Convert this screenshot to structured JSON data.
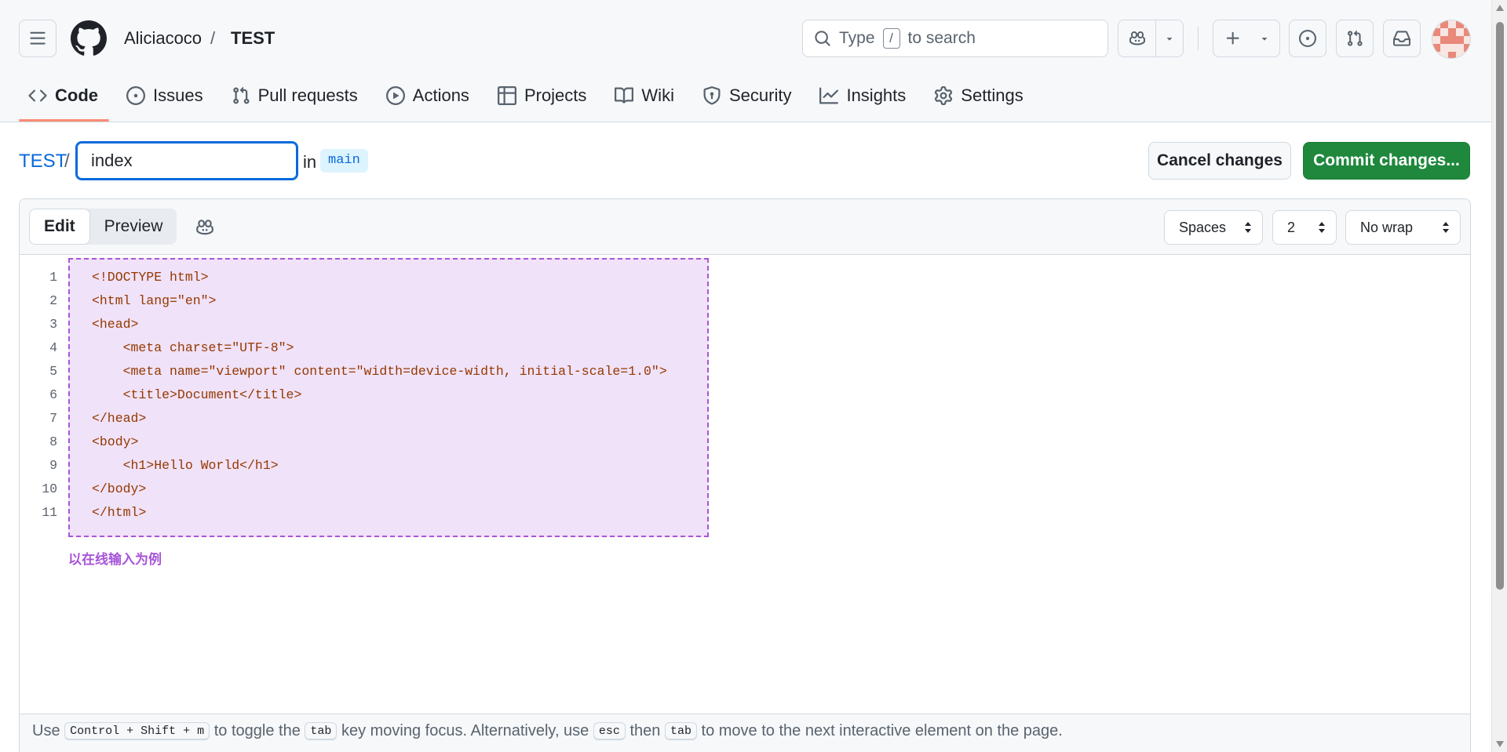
{
  "header": {
    "owner": "Aliciacoco",
    "separator": "/",
    "repo": "TEST",
    "search": {
      "prefix": "Type",
      "key": "/",
      "suffix": "to search"
    }
  },
  "nav": {
    "items": [
      {
        "label": "Code",
        "icon": "code-icon",
        "active": true
      },
      {
        "label": "Issues",
        "icon": "issue-opened-icon"
      },
      {
        "label": "Pull requests",
        "icon": "git-pull-request-icon"
      },
      {
        "label": "Actions",
        "icon": "play-icon"
      },
      {
        "label": "Projects",
        "icon": "table-icon"
      },
      {
        "label": "Wiki",
        "icon": "book-icon"
      },
      {
        "label": "Security",
        "icon": "shield-icon"
      },
      {
        "label": "Insights",
        "icon": "graph-icon"
      },
      {
        "label": "Settings",
        "icon": "gear-icon"
      }
    ]
  },
  "file": {
    "repo": "TEST",
    "separator": "/",
    "filename": "index",
    "in_label": "in",
    "branch": "main",
    "cancel_label": "Cancel changes",
    "commit_label": "Commit changes..."
  },
  "editor": {
    "tabs": {
      "edit": "Edit",
      "preview": "Preview"
    },
    "indent_mode": "Spaces",
    "indent_size": "2",
    "wrap_mode": "No wrap",
    "lines": [
      "<!DOCTYPE html>",
      "<html lang=\"en\">",
      "<head>",
      "    <meta charset=\"UTF-8\">",
      "    <meta name=\"viewport\" content=\"width=device-width, initial-scale=1.0\">",
      "    <title>Document</title>",
      "</head>",
      "<body>",
      "    <h1>Hello World</h1>",
      "</body>",
      "</html>"
    ],
    "annotation": "以在线输入为例",
    "footer": {
      "t1": "Use",
      "k1": "Control + Shift + m",
      "t2": "to toggle the",
      "k2": "tab",
      "t3": "key moving focus. Alternatively, use",
      "k3": "esc",
      "t4": "then",
      "k4": "tab",
      "t5": "to move to the next interactive element on the page."
    }
  },
  "colors": {
    "accent": "#0969da",
    "commit_green": "#1f883d",
    "nav_underline": "#fd8c73",
    "annotation_purple": "#a855d8",
    "highlight_bg": "#f0e2f8"
  }
}
